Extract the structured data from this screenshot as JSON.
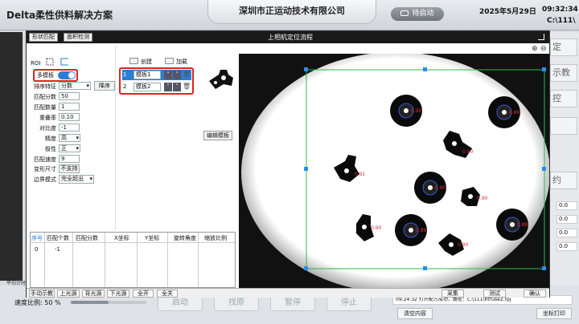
{
  "header": {
    "app_title": "Delta柔性供料解决方案",
    "company": "深圳市正运动技术有限公司",
    "start_button": "待启动",
    "date": "2025年5月29日",
    "time": "09:32:34",
    "path": "C:\\111\\"
  },
  "background": {
    "side_buttons": [
      "定",
      "示教",
      "控",
      "",
      "约"
    ],
    "side_values": [
      "0.0",
      "0.0",
      "0.0",
      "0.0"
    ],
    "speed_label": "速度比例: 50 %",
    "speed_fraction": 0.5,
    "avg_label": "平均计时",
    "big_buttons": [
      "启动",
      "找原",
      "暂停",
      "停止"
    ],
    "log_text": "09:24:32  打开配方成功，路径：C:\\111\\Rtfuse2.rpj",
    "clear_button": "清空内容",
    "coord_button": "坐标打印"
  },
  "dialog": {
    "tabs": [
      "形状匹配",
      "面积检测"
    ],
    "title": "上相机定位流程",
    "roi_label": "ROI",
    "multi_template_label": "多模板",
    "multi_template_on": true,
    "sort_button": "降序",
    "params": [
      {
        "label": "排序特征",
        "value": "分数",
        "type": "select"
      },
      {
        "label": "匹配分数",
        "value": "50",
        "type": "field"
      },
      {
        "label": "匹配数量",
        "value": "1",
        "type": "field"
      },
      {
        "label": "重叠率",
        "value": "0.10",
        "type": "field"
      },
      {
        "label": "对比度",
        "value": "-1",
        "type": "field"
      },
      {
        "label": "精度",
        "value": "高",
        "type": "select"
      },
      {
        "label": "极性",
        "value": "正",
        "type": "select"
      },
      {
        "label": "匹配速度",
        "value": "9",
        "type": "field"
      },
      {
        "label": "变形尺寸",
        "value": "不支持",
        "type": "button"
      },
      {
        "label": "边界模式",
        "value": "完全超出",
        "type": "select"
      }
    ],
    "create_label": "创建",
    "load_label": "加载",
    "templates": [
      {
        "index": "1",
        "name": "模板1",
        "selected": true
      },
      {
        "index": "2",
        "name": "模板2",
        "selected": false
      }
    ],
    "edit_template": "编辑模板",
    "results": {
      "headers": [
        "序号",
        "匹配个数",
        "匹配分数",
        "X坐标",
        "Y坐标",
        "旋转角度",
        "缩放比例"
      ],
      "rows": [
        [
          "0",
          "-1",
          "",
          "",
          "",
          "",
          ""
        ]
      ]
    },
    "bottom_left_buttons": [
      "手动示教",
      "上光源",
      "背光源",
      "下光源",
      "全开",
      "全关"
    ],
    "bottom_right_buttons": [
      "采集",
      "测试",
      "确认"
    ],
    "camera_labels": [
      "0.90",
      "0.89",
      "0.90",
      "0.91",
      "0.90",
      "0.90",
      "0.89",
      "0.90",
      "0.89",
      "0.90",
      "0.90"
    ]
  }
}
